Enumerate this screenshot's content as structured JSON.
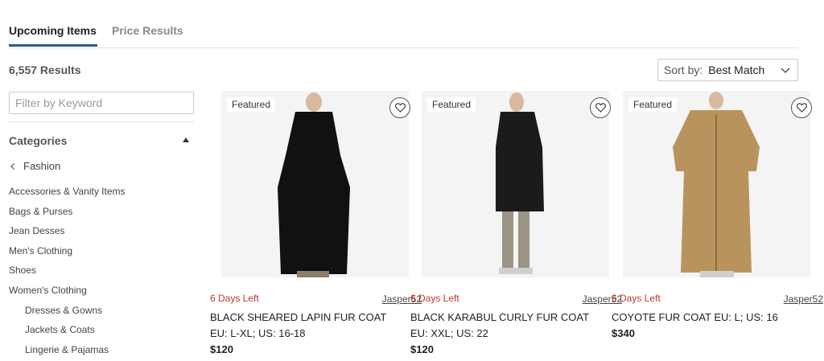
{
  "tabs": {
    "upcoming": "Upcoming Items",
    "price_results": "Price Results"
  },
  "results_count": "6,557 Results",
  "sort": {
    "label": "Sort by:",
    "value": "Best Match"
  },
  "filter": {
    "placeholder": "Filter by Keyword"
  },
  "categories": {
    "title": "Categories",
    "parent": "Fashion",
    "items": [
      "Accessories & Vanity Items",
      "Bags & Purses",
      "Jean Desses",
      "Men's Clothing",
      "Shoes",
      "Women's Clothing"
    ],
    "sub_items": [
      "Dresses & Gowns",
      "Jackets & Coats",
      "Lingerie & Pajamas"
    ]
  },
  "products": [
    {
      "badge": "Featured",
      "days_left": "6 Days Left",
      "seller": "Jasper52",
      "title": "BLACK SHEARED LAPIN FUR COAT",
      "size": "EU: L-XL; US: 16-18",
      "price": "$120",
      "coat_color": "#111111"
    },
    {
      "badge": "Featured",
      "days_left": "6 Days Left",
      "seller": "Jasper52",
      "title": "BLACK KARABUL CURLY FUR COAT",
      "size": "EU: XXL; US: 22",
      "price": "$120",
      "coat_color": "#1b1b1b"
    },
    {
      "badge": "Featured",
      "days_left": "6 Days Left",
      "seller": "Jasper52",
      "title": "COYOTE FUR COAT EU: L; US: 16",
      "price": "$340",
      "coat_color": "#b9935e"
    }
  ],
  "icons": {
    "sort_chevron": "chevron-down-icon",
    "category_toggle": "caret-up-icon",
    "back": "chevron-left-icon",
    "favorite": "heart-icon"
  }
}
